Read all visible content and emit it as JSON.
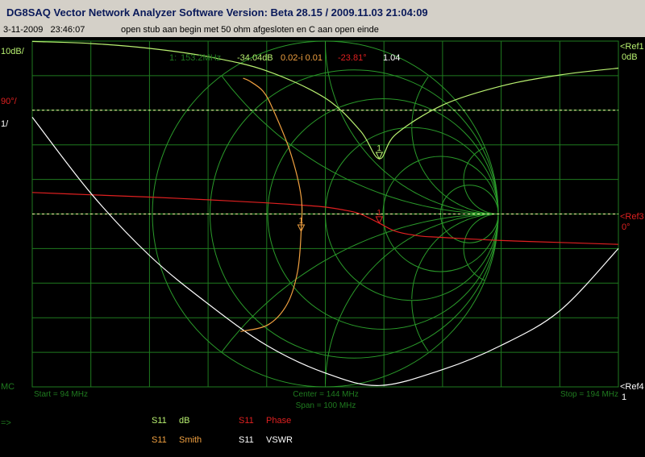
{
  "window": {
    "title": "DG8SAQ Vector Network Analyzer Software   Version:  Beta 28.15 / 2009.11.03 21:04:09"
  },
  "info": {
    "date": "3-11-2009",
    "time": "23:46:07",
    "description": "open stub aan begin met 50 ohm afgesloten en C aan open einde"
  },
  "colors": {
    "s11_db": "#b8f070",
    "s11_phase": "#e02020",
    "s11_smith": "#f0a040",
    "s11_vswr": "#ffffff",
    "grid": "#1f7a1f",
    "ref_line": "#ffffaa",
    "smith_grid": "#2a9a2a"
  },
  "left_labels": {
    "db_scale": "10dB/",
    "phase_scale": "90°/",
    "vswr_scale": "1/",
    "mc": "MC",
    "arrow": "=>"
  },
  "right_labels": {
    "ref1": "<Ref1",
    "ref1_val": "0dB",
    "ref3": "<Ref3",
    "ref3_val": "0°",
    "ref4": "<Ref4",
    "ref4_val": "1"
  },
  "marker": {
    "id": "1:",
    "freq": "153.2MHz",
    "db": "-34.04dB",
    "impedance": "0.02-i 0.01",
    "phase": "-23.81°",
    "vswr": "1.04",
    "label": "1"
  },
  "freq": {
    "start": "Start = 94 MHz",
    "center": "Center = 144 MHz",
    "span": "Span = 100 MHz",
    "stop": "Stop = 194 MHz"
  },
  "legend": [
    {
      "param": "S11",
      "name": "dB",
      "color": "#b8f070"
    },
    {
      "param": "S11",
      "name": "Phase",
      "color": "#e02020"
    },
    {
      "param": "S11",
      "name": "Smith",
      "color": "#f0a040"
    },
    {
      "param": "S11",
      "name": "VSWR",
      "color": "#ffffff"
    }
  ],
  "chart_data": {
    "type": "line",
    "title": "",
    "x_start_mhz": 94,
    "x_stop_mhz": 194,
    "grid": true,
    "divisions": {
      "x": 10,
      "y": 10
    },
    "marker_mhz": 153.2,
    "series": [
      {
        "name": "S11 dB",
        "unit": "dB",
        "scale_per_div": 10,
        "ref_value": 0,
        "ref_div": 0,
        "x": [
          94,
          104,
          114,
          124,
          134,
          144,
          150,
          153.2,
          156,
          164,
          174,
          184,
          194
        ],
        "values": [
          -0.1,
          -0.7,
          -2.1,
          -4.5,
          -8.6,
          -16.5,
          -26,
          -34.04,
          -27,
          -18.5,
          -13,
          -9.8,
          -7.8
        ]
      },
      {
        "name": "S11 Phase",
        "unit": "deg",
        "scale_per_div": 90,
        "ref_value": 0,
        "ref_div": 5,
        "x": [
          94,
          104,
          114,
          124,
          134,
          140,
          144,
          148,
          150,
          153.2,
          156,
          160,
          164,
          174,
          184,
          194
        ],
        "values": [
          56,
          50,
          44,
          37,
          29,
          23,
          18,
          8,
          0,
          -23.81,
          -45,
          -57,
          -61,
          -69,
          -74,
          -79
        ]
      },
      {
        "name": "S11 VSWR",
        "unit": "ratio",
        "scale_per_div": 1,
        "ref_value": 1,
        "ref_div": 10,
        "x": [
          94,
          104,
          114,
          124,
          134,
          144,
          153.2,
          164,
          174,
          184,
          194
        ],
        "values": [
          8.8,
          6.6,
          4.8,
          3.4,
          2.2,
          1.4,
          1.04,
          1.5,
          2.2,
          3.2,
          5.0
        ]
      }
    ],
    "smith": {
      "name": "S11 Smith",
      "re": [
        -0.475,
        -0.44,
        -0.36,
        -0.3,
        -0.2,
        -0.14,
        -0.14,
        -0.16,
        -0.22,
        -0.33,
        -0.49
      ],
      "im": [
        0.785,
        0.77,
        0.71,
        0.6,
        0.35,
        0.1,
        -0.1,
        -0.33,
        -0.52,
        -0.64,
        -0.68
      ]
    }
  }
}
